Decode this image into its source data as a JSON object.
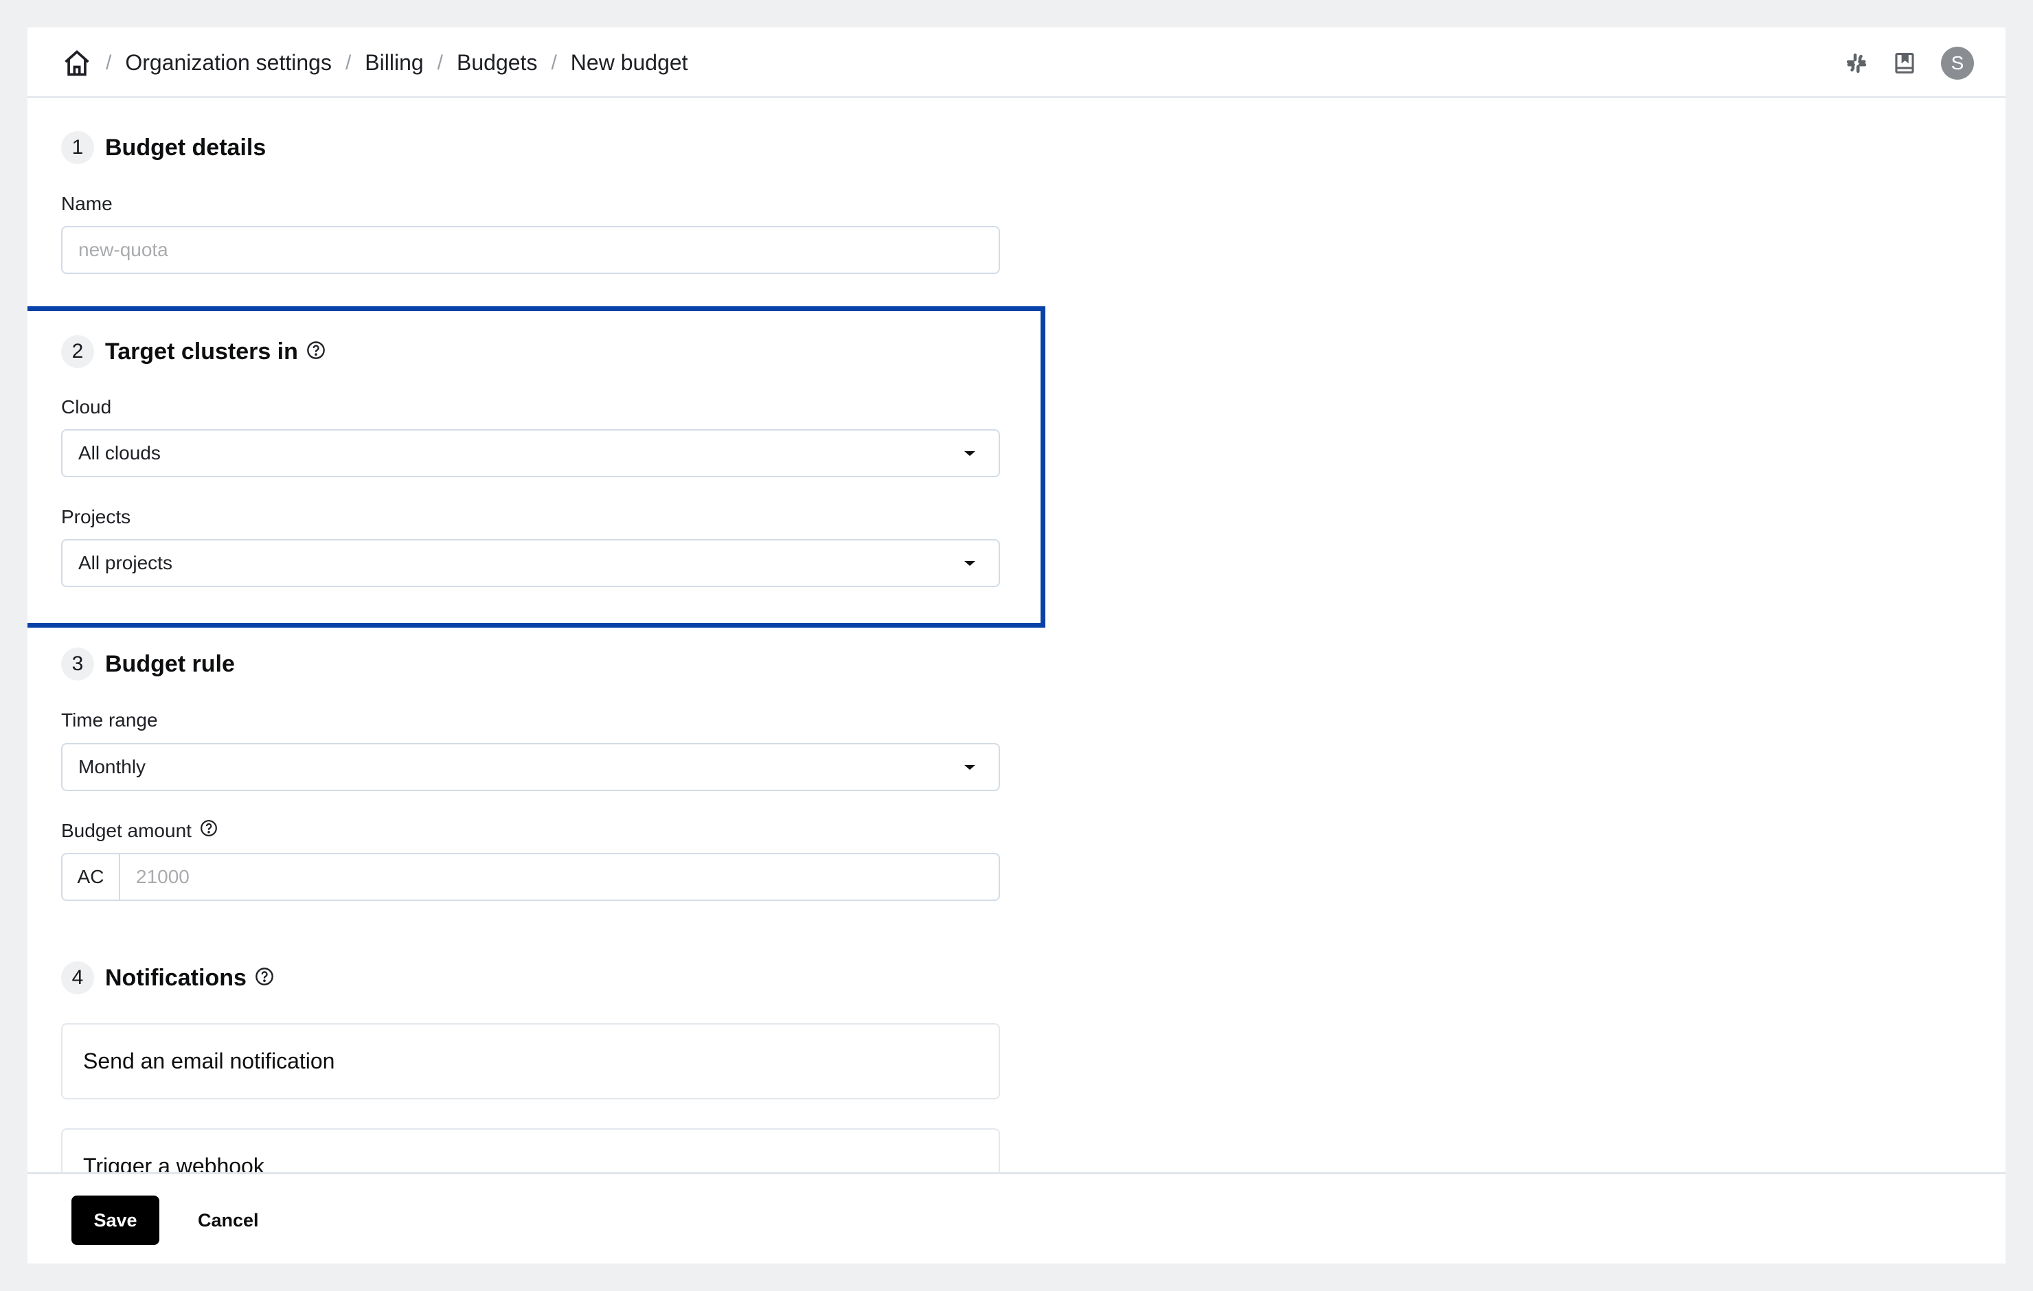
{
  "breadcrumb": {
    "home_icon": "home-icon",
    "items": [
      "Organization settings",
      "Billing",
      "Budgets",
      "New budget"
    ],
    "separator": "/"
  },
  "header_icons": {
    "slack": "slack-icon",
    "docs": "book-icon",
    "avatar_initial": "S"
  },
  "sections": [
    {
      "number": "1",
      "title": "Budget details",
      "fields": [
        {
          "label": "Name",
          "value": "",
          "placeholder": "new-quota"
        }
      ]
    },
    {
      "number": "2",
      "title": "Target clusters in",
      "help": true,
      "fields": [
        {
          "label": "Cloud",
          "value": "All clouds"
        },
        {
          "label": "Projects",
          "value": "All projects"
        }
      ]
    },
    {
      "number": "3",
      "title": "Budget rule",
      "fields": [
        {
          "label": "Time range",
          "value": "Monthly"
        },
        {
          "label": "Budget amount",
          "prefix": "AC",
          "value": "",
          "placeholder": "21000"
        }
      ]
    },
    {
      "number": "4",
      "title": "Notifications",
      "options": [
        "Send an email notification",
        "Trigger a webhook"
      ]
    }
  ],
  "highlight_color": "#0842A8",
  "footer": {
    "save_label": "Save",
    "cancel_label": "Cancel"
  }
}
